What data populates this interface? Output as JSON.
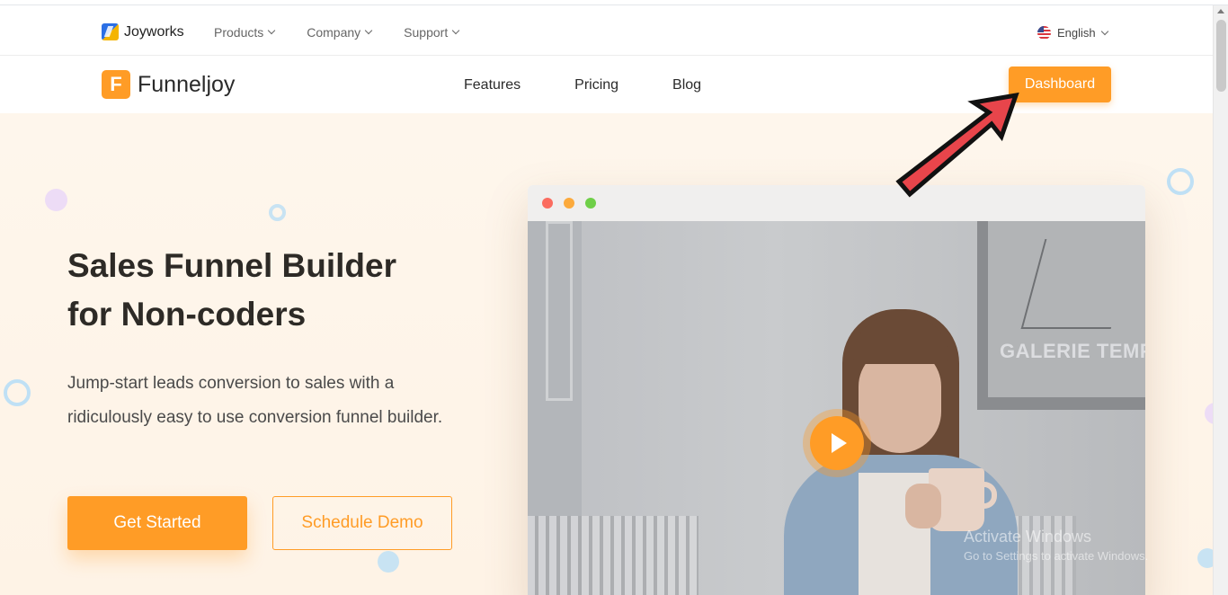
{
  "topbar": {
    "brand": "Joyworks",
    "nav": [
      {
        "label": "Products"
      },
      {
        "label": "Company"
      },
      {
        "label": "Support"
      }
    ],
    "language": "English"
  },
  "header": {
    "brand": "Funneljoy",
    "brand_initial": "F",
    "nav": [
      {
        "label": "Features"
      },
      {
        "label": "Pricing"
      },
      {
        "label": "Blog"
      }
    ],
    "dashboard_label": "Dashboard"
  },
  "hero": {
    "headline_line1": "Sales Funnel Builder",
    "headline_line2": "for Non-coders",
    "subtitle": "Jump-start leads conversion to sales with a ridiculously easy to use conversion funnel builder.",
    "primary_cta": "Get Started",
    "secondary_cta": "Schedule Demo"
  },
  "video": {
    "poster_text": "GALERIE TEMPO",
    "play_icon": "play-icon"
  },
  "watermark": {
    "title": "Activate Windows",
    "subtitle": "Go to Settings to activate Windows."
  },
  "colors": {
    "accent": "#ff9c26",
    "hero_bg": "#fef6ec",
    "annotation_arrow": "#e8454b"
  }
}
